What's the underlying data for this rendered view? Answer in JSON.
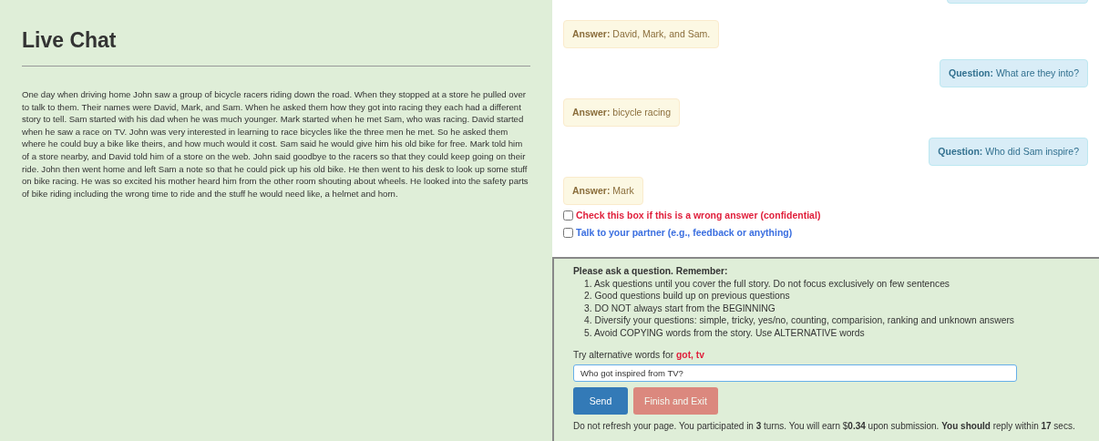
{
  "story_panel": {
    "title": "Live Chat",
    "story": "One day when driving home John saw a group of bicycle racers riding down the road. When they stopped at a store he pulled over to talk to them. Their names were David, Mark, and Sam. When he asked them how they got into racing they each had a different story to tell. Sam started with his dad when he was much younger. Mark started when he met Sam, who was racing. David started when he saw a race on TV. John was very interested in learning to race bicycles like the three men he met. So he asked them where he could buy a bike like theirs, and how much would it cost. Sam said he would give him his old bike for free. Mark told him of a store nearby, and David told him of a store on the web. John said goodbye to the racers so that they could keep going on their ride. John then went home and left Sam a note so that he could pick up his old bike. He then went to his desk to look up some stuff on bike racing. He was so excited his mother heard him from the other room shouting about wheels. He looked into the safety parts of bike riding including the wrong time to ride and the stuff he would need like, a helmet and horn."
  },
  "messages": [
    {
      "kind": "answer",
      "text": "**Answer:** David, Mark, and Sam."
    },
    {
      "kind": "question",
      "text": "**Question:** What are they into?"
    },
    {
      "kind": "answer",
      "text": "**Answer:** bicycle racing"
    },
    {
      "kind": "question",
      "text": "**Question:** Who did Sam inspire?"
    },
    {
      "kind": "answer",
      "text": "**Answer:** Mark"
    }
  ],
  "options": [
    {
      "label": "Check this box if this is a wrong answer (confidential)",
      "checked": false,
      "color": "#e0203c"
    },
    {
      "label": "Talk to your partner (e.g., feedback or anything)",
      "checked": false,
      "color": "#3b6fe0"
    }
  ],
  "question_form": {
    "heading": "Please ask a question. Remember:",
    "rules": [
      "1. Ask questions until you cover the full story. Do not focus exclusively on few sentences",
      "2. Good questions build up on previous questions",
      "3. DO NOT always start from the BEGINNING",
      "4. Diversify your questions: simple, tricky, yes/no, counting, comparision, ranking and unknown answers",
      "5. Avoid COPYING words from the story. Use ALTERNATIVE words"
    ],
    "hint": "Try alternative words for",
    "hint_words": "got, tv",
    "value": "Who got inspired from TV?",
    "buttons": [
      {
        "label": "Send",
        "kind": "primary",
        "disabled": false
      },
      {
        "label": "Finish and Exit",
        "kind": "danger",
        "disabled": true
      }
    ],
    "status": "Do not refresh your page. You participated in **3** turns. You will earn $**0.34** upon submission. **You should** reply within **17** secs."
  }
}
